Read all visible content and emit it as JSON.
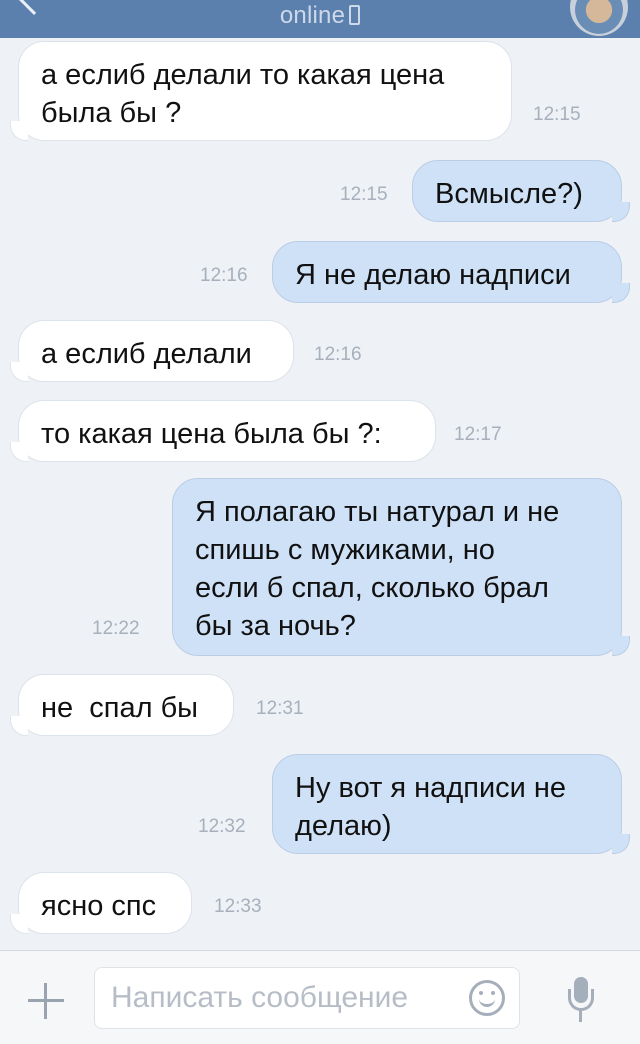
{
  "header": {
    "status": "online",
    "back_icon": "chevron-left-icon",
    "avatar_icon": "contact-avatar"
  },
  "messages": [
    {
      "dir": "in",
      "text": "а еслиб делали то какая цена\nбыла бы ?",
      "time": "12:15"
    },
    {
      "dir": "out",
      "text": "Всмысле?)",
      "time": "12:15"
    },
    {
      "dir": "out",
      "text": "Я не делаю надписи",
      "time": "12:16"
    },
    {
      "dir": "in",
      "text": "а еслиб делали",
      "time": "12:16"
    },
    {
      "dir": "in",
      "text": "то какая цена была бы ?:",
      "time": "12:17"
    },
    {
      "dir": "out",
      "text": "Я полагаю ты натурал и не\nспишь с мужиками, но\nесли б спал, сколько брал\nбы за ночь?",
      "time": "12:22"
    },
    {
      "dir": "in",
      "text": "не  спал бы",
      "time": "12:31"
    },
    {
      "dir": "out",
      "text": "Ну вот я надписи не\nделаю)",
      "time": "12:32"
    },
    {
      "dir": "in",
      "text": "ясно спс",
      "time": "12:33"
    }
  ],
  "composer": {
    "placeholder": "Написать сообщение",
    "attach_icon": "plus-icon",
    "emoji_icon": "smiley-icon",
    "voice_icon": "microphone-icon"
  },
  "colors": {
    "header": "#5b80ae",
    "incoming_bubble": "#ffffff",
    "outgoing_bubble": "#cfe1f7",
    "background": "#eef1f6"
  }
}
